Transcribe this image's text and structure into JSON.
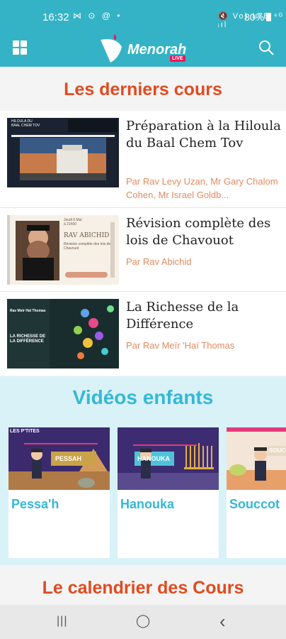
{
  "status": {
    "time": "16:32",
    "notifications": "⋈ ⊙ @ •",
    "system": "🔇 Vo) LTE ⁴ᴳ ᵢıl",
    "battery": "80%"
  },
  "app": {
    "logo_text": "Menorah",
    "logo_badge": "LIVE"
  },
  "latest": {
    "title": "Les derniers cours",
    "items": [
      {
        "title": "Préparation à la Hiloula du Baal Chem Tov",
        "author": "Par Rav Levy Uzan, Mr Gary Chalom Cohen, Mr Israel Goldb...",
        "thumb_text": [
          "HILOULA DU",
          "BAAL CHEM TOV"
        ]
      },
      {
        "title": "Révision complète des lois de Chavouot",
        "author": "Par Rav Abichid",
        "thumb_text": [
          "Jeudi 6 Mai",
          "à 21h00",
          "RAV ABICHID",
          "Révision complète des lois de Chavouot"
        ]
      },
      {
        "title": "La Richesse de la Différence",
        "author": "Par Rav Meïr 'Haï Thomas",
        "thumb_text": [
          "Rav Meïr Haï Thomas",
          "LA RICHESSE DE LA DIFFÉRENCE"
        ]
      }
    ]
  },
  "kids": {
    "title": "Vidéos enfants",
    "items": [
      {
        "label": "Pessa'h",
        "thumb_text": "PESSAH",
        "corner": "LES P'TITES"
      },
      {
        "label": "Hanouka",
        "thumb_text": "HANOUKA"
      },
      {
        "label": "Souccot",
        "thumb_text": "SOUCC"
      }
    ]
  },
  "calendar": {
    "title": "Le calendrier des Cours"
  },
  "nav": {
    "recents": "|||",
    "home": "◯",
    "back": "‹"
  }
}
